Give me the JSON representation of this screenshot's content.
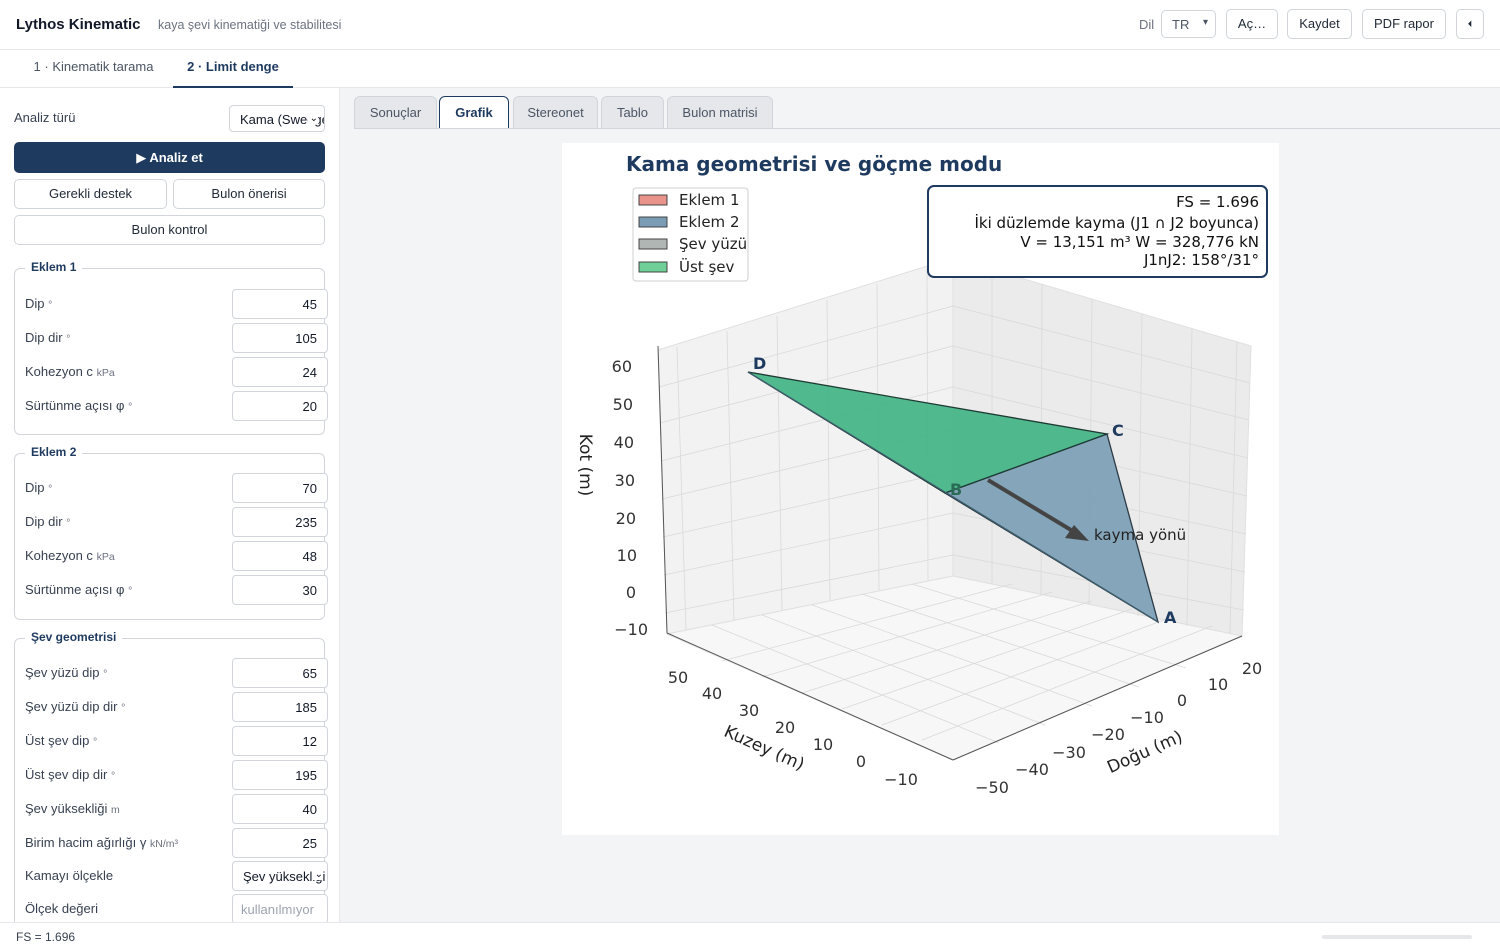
{
  "app": {
    "title": "Lythos Kinematic",
    "tagline": "kaya şevi kinematiği ve stabilitesi"
  },
  "header": {
    "lang_label": "Dil",
    "lang_value": "TR",
    "open_label": "Aç…",
    "save_label": "Kaydet",
    "pdf_label": "PDF rapor",
    "collapse_glyph": "⏴"
  },
  "main_tabs": [
    {
      "label": "1 · Kinematik tarama",
      "active": false
    },
    {
      "label": "2 · Limit denge",
      "active": true
    }
  ],
  "sidebar": {
    "analysis_type_label": "Analiz türü",
    "analysis_type_value": "Kama (Swedge)",
    "run_label": "▶ Analiz et",
    "support_label": "Gerekli destek",
    "bolt_suggest_label": "Bulon önerisi",
    "bolt_check_label": "Bulon kontrol",
    "joint1": {
      "title": "Eklem 1",
      "fields": [
        {
          "label": "Dip",
          "unit": "°",
          "value": "45"
        },
        {
          "label": "Dip dir",
          "unit": "°",
          "value": "105"
        },
        {
          "label": "Kohezyon c",
          "unit": "kPa",
          "value": "24"
        },
        {
          "label": "Sürtünme açısı φ",
          "unit": "°",
          "value": "20"
        }
      ]
    },
    "joint2": {
      "title": "Eklem 2",
      "fields": [
        {
          "label": "Dip",
          "unit": "°",
          "value": "70"
        },
        {
          "label": "Dip dir",
          "unit": "°",
          "value": "235"
        },
        {
          "label": "Kohezyon c",
          "unit": "kPa",
          "value": "48"
        },
        {
          "label": "Sürtünme açısı φ",
          "unit": "°",
          "value": "30"
        }
      ]
    },
    "slope": {
      "title": "Şev geometrisi",
      "fields": [
        {
          "label": "Şev yüzü dip",
          "unit": "°",
          "value": "65"
        },
        {
          "label": "Şev yüzü dip dir",
          "unit": "°",
          "value": "185"
        },
        {
          "label": "Üst şev dip",
          "unit": "°",
          "value": "12"
        },
        {
          "label": "Üst şev dip dir",
          "unit": "°",
          "value": "195"
        },
        {
          "label": "Şev yüksekliği",
          "unit": "m",
          "value": "40"
        },
        {
          "label": "Birim hacim ağırlığı γ",
          "unit": "kN/m³",
          "value": "25"
        }
      ],
      "scale_label": "Kamayı ölçekle",
      "scale_value": "Şev yüksekliği",
      "scale_amount_label": "Ölçek değeri",
      "scale_amount_placeholder": "kullanılmıyor"
    }
  },
  "sub_tabs": [
    {
      "label": "Sonuçlar",
      "active": false
    },
    {
      "label": "Grafik",
      "active": true
    },
    {
      "label": "Stereonet",
      "active": false
    },
    {
      "label": "Tablo",
      "active": false
    },
    {
      "label": "Bulon matrisi",
      "active": false
    }
  ],
  "status": {
    "text": "FS = 1.696"
  },
  "colors": {
    "accent": "#1e3a5f",
    "joint1": "#e8948a",
    "joint2": "#7a9db5",
    "face": "#b0b6b4",
    "upper": "#6fcf97"
  },
  "chart_data": {
    "type": "3d-wedge",
    "title": "Kama geometrisi ve göçme modu",
    "legend": [
      "Eklem 1",
      "Eklem 2",
      "Şev yüzü",
      "Üst şev"
    ],
    "legend_position": "top-left",
    "info_box": [
      "FS = 1.696",
      "İki düzlemde kayma (J1 ∩ J2 boyunca)",
      "V = 13,151 m³   W = 328,776 kN",
      "J1nJ2: 158°/31°"
    ],
    "xlabel": "Doğu (m)",
    "ylabel": "Kuzey (m)",
    "zlabel": "Kot (m)",
    "x_ticks": [
      "20",
      "10",
      "0",
      "−10",
      "−20",
      "−30",
      "−40",
      "−50"
    ],
    "y_ticks": [
      "50",
      "40",
      "30",
      "20",
      "10",
      "0",
      "−10"
    ],
    "z_ticks": [
      "60",
      "50",
      "40",
      "30",
      "20",
      "10",
      "0",
      "−10"
    ],
    "vertices": [
      "A",
      "B",
      "C",
      "D"
    ],
    "arrow_label": "kayma yönü"
  }
}
